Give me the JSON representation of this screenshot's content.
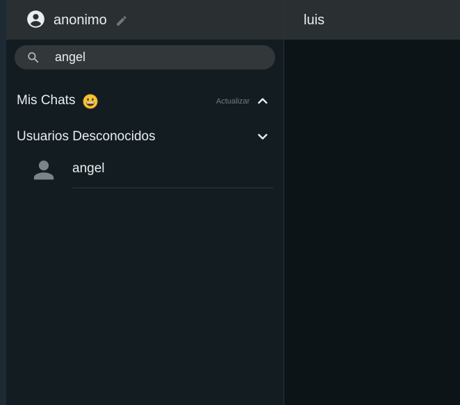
{
  "sidebar": {
    "profile": {
      "username": "anonimo",
      "account_icon": "account-circle-icon",
      "edit_icon": "pencil-icon"
    },
    "search": {
      "value": "angel",
      "placeholder": "",
      "icon": "search-icon"
    },
    "my_chats": {
      "title": "Mis Chats",
      "emoji": "grinning-face-icon",
      "refresh_label": "Actualizar",
      "toggle_icon": "chevron-up-icon"
    },
    "unknown_users": {
      "title": "Usuarios Desconocidos",
      "toggle_icon": "chevron-down-icon",
      "users": [
        {
          "name": "angel",
          "avatar": "person-icon"
        }
      ]
    }
  },
  "chat": {
    "title": "luis"
  },
  "colors": {
    "header_bg": "#2a2f32",
    "sidebar_bg": "#131c21",
    "chat_bg": "#0d1418",
    "search_bg": "#323739",
    "text_primary": "#e9edef",
    "text_muted": "#6e7b80"
  }
}
